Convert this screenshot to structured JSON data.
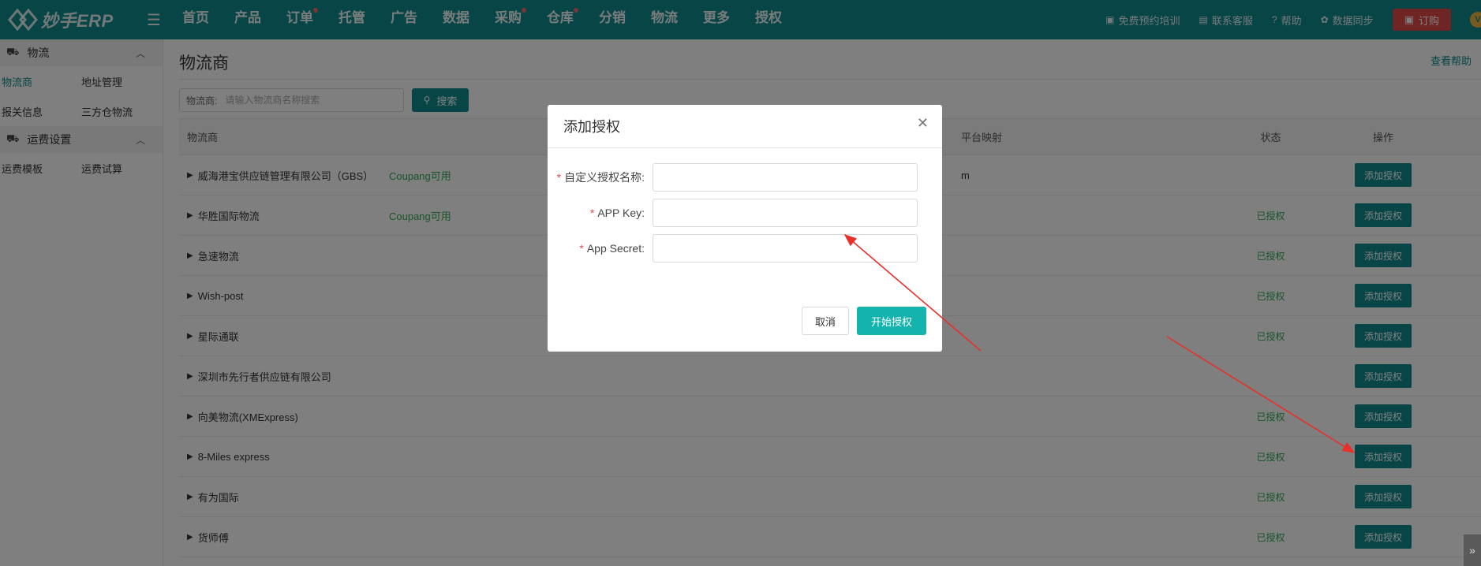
{
  "brand": {
    "logo_text": "妙手ERP"
  },
  "nav": {
    "items": [
      {
        "label": "首页",
        "dot": false
      },
      {
        "label": "产品",
        "dot": false
      },
      {
        "label": "订单",
        "dot": true
      },
      {
        "label": "托管",
        "dot": false
      },
      {
        "label": "广告",
        "dot": false
      },
      {
        "label": "数据",
        "dot": false
      },
      {
        "label": "采购",
        "dot": true
      },
      {
        "label": "仓库",
        "dot": true
      },
      {
        "label": "分销",
        "dot": false
      },
      {
        "label": "物流",
        "dot": false
      },
      {
        "label": "更多",
        "dot": false
      },
      {
        "label": "授权",
        "dot": false
      }
    ],
    "right": {
      "training": "免费预约培训",
      "support": "联系客服",
      "help": "帮助",
      "sync": "数据同步",
      "order": "订购",
      "avatar": "V"
    }
  },
  "sidebar": {
    "group1": {
      "title": "物流"
    },
    "group1_items": [
      "物流商",
      "地址管理",
      "报关信息",
      "三方仓物流"
    ],
    "group2": {
      "title": "运费设置"
    },
    "group2_items": [
      "运费模板",
      "运费试算"
    ]
  },
  "page": {
    "title": "物流商",
    "help": "查看帮助",
    "search_label": "物流商:",
    "search_placeholder": "请输入物流商名称搜索",
    "search_button": "搜索"
  },
  "table": {
    "headers": {
      "name": "物流商",
      "mapping": "平台映射",
      "status": "状态",
      "op": "操作"
    },
    "action_label": "添加授权",
    "rows": [
      {
        "name": "威海港宝供应链管理有限公司（GBS）",
        "avail": "Coupang可用",
        "mapping": "m",
        "status": ""
      },
      {
        "name": "华胜国际物流",
        "avail": "Coupang可用",
        "mapping": "",
        "status": "已授权"
      },
      {
        "name": "急速物流",
        "avail": "",
        "mapping": "",
        "status": "已授权"
      },
      {
        "name": "Wish-post",
        "avail": "",
        "mapping": "",
        "status": "已授权"
      },
      {
        "name": "星际通联",
        "avail": "",
        "mapping": "",
        "status": "已授权"
      },
      {
        "name": "深圳市先行者供应链有限公司",
        "avail": "",
        "mapping": "",
        "status": ""
      },
      {
        "name": "向美物流(XMExpress)",
        "avail": "",
        "mapping": "",
        "status": "已授权"
      },
      {
        "name": "8-Miles express",
        "avail": "",
        "mapping": "",
        "status": "已授权"
      },
      {
        "name": "有为国际",
        "avail": "",
        "mapping": "",
        "status": "已授权"
      },
      {
        "name": "货师傅",
        "avail": "",
        "mapping": "",
        "status": "已授权"
      }
    ]
  },
  "modal": {
    "title": "添加授权",
    "fields": [
      {
        "label": "自定义授权名称:",
        "value": ""
      },
      {
        "label": "APP Key:",
        "value": ""
      },
      {
        "label": "App Secret:",
        "value": ""
      }
    ],
    "cancel": "取消",
    "submit": "开始授权"
  },
  "colors": {
    "primary": "#0f8b8d",
    "accent": "#14b3ad",
    "danger": "#e14b4b",
    "success": "#2fa84f"
  }
}
